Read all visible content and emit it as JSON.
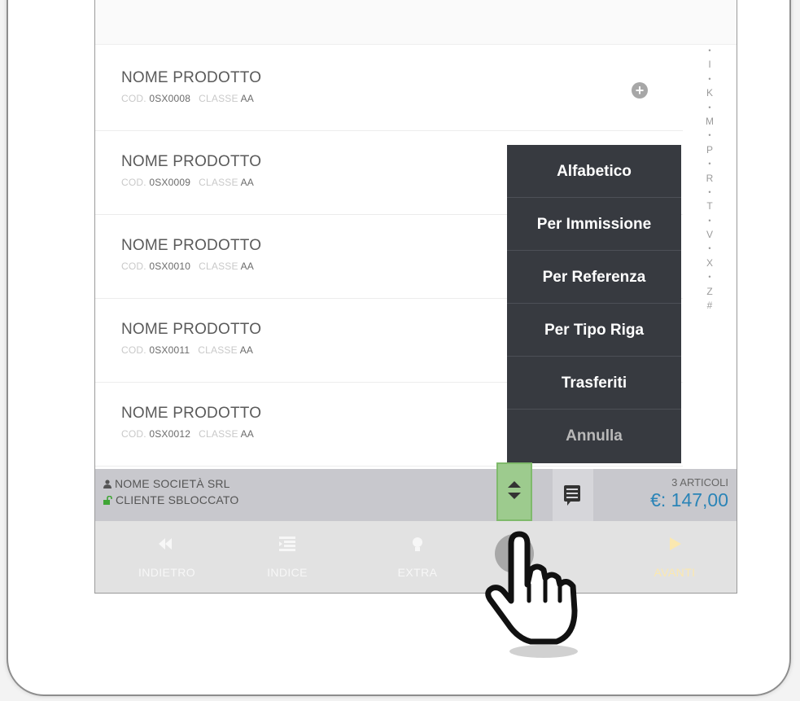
{
  "products": [
    {
      "name": "NOME PRODOTTO",
      "cod_label": "COD.",
      "cod": "0SX0008",
      "class_label": "CLASSE",
      "class": "AA",
      "show_add": true
    },
    {
      "name": "NOME PRODOTTO",
      "cod_label": "COD.",
      "cod": "0SX0009",
      "class_label": "CLASSE",
      "class": "AA",
      "show_add": false
    },
    {
      "name": "NOME PRODOTTO",
      "cod_label": "COD.",
      "cod": "0SX0010",
      "class_label": "CLASSE",
      "class": "AA",
      "show_add": false
    },
    {
      "name": "NOME PRODOTTO",
      "cod_label": "COD.",
      "cod": "0SX0011",
      "class_label": "CLASSE",
      "class": "AA",
      "show_add": false
    },
    {
      "name": "NOME PRODOTTO",
      "cod_label": "COD.",
      "cod": "0SX0012",
      "class_label": "CLASSE",
      "class": "AA",
      "show_add": false
    }
  ],
  "add_icon": "plus-circle-icon",
  "alphabet_index": [
    "•",
    "I",
    "•",
    "K",
    "•",
    "M",
    "•",
    "P",
    "•",
    "R",
    "•",
    "T",
    "•",
    "V",
    "•",
    "X",
    "•",
    "Z",
    "#"
  ],
  "sort_menu": {
    "items": [
      "Alfabetico",
      "Per Immissione",
      "Per Referenza",
      "Per Tipo Riga",
      "Trasferiti"
    ],
    "cancel": "Annulla"
  },
  "customer": {
    "company": "NOME SOCIETÀ SRL",
    "status": "CLIENTE SBLOCCATO",
    "company_icon": "user-icon",
    "status_icon": "unlock-icon",
    "status_icon_color": "#3fa535"
  },
  "totals": {
    "articles": "3 ARTICOLI",
    "price": "€: 147,00",
    "price_color": "#2a84b7"
  },
  "nav": {
    "back": "INDIETRO",
    "index": "INDICE",
    "extra": "EXTRA",
    "next": "AVANTI"
  },
  "colors": {
    "menu_bg": "#373a40",
    "sort_button": "#9dcb8e",
    "customer_bar": "#c8c8cd"
  }
}
